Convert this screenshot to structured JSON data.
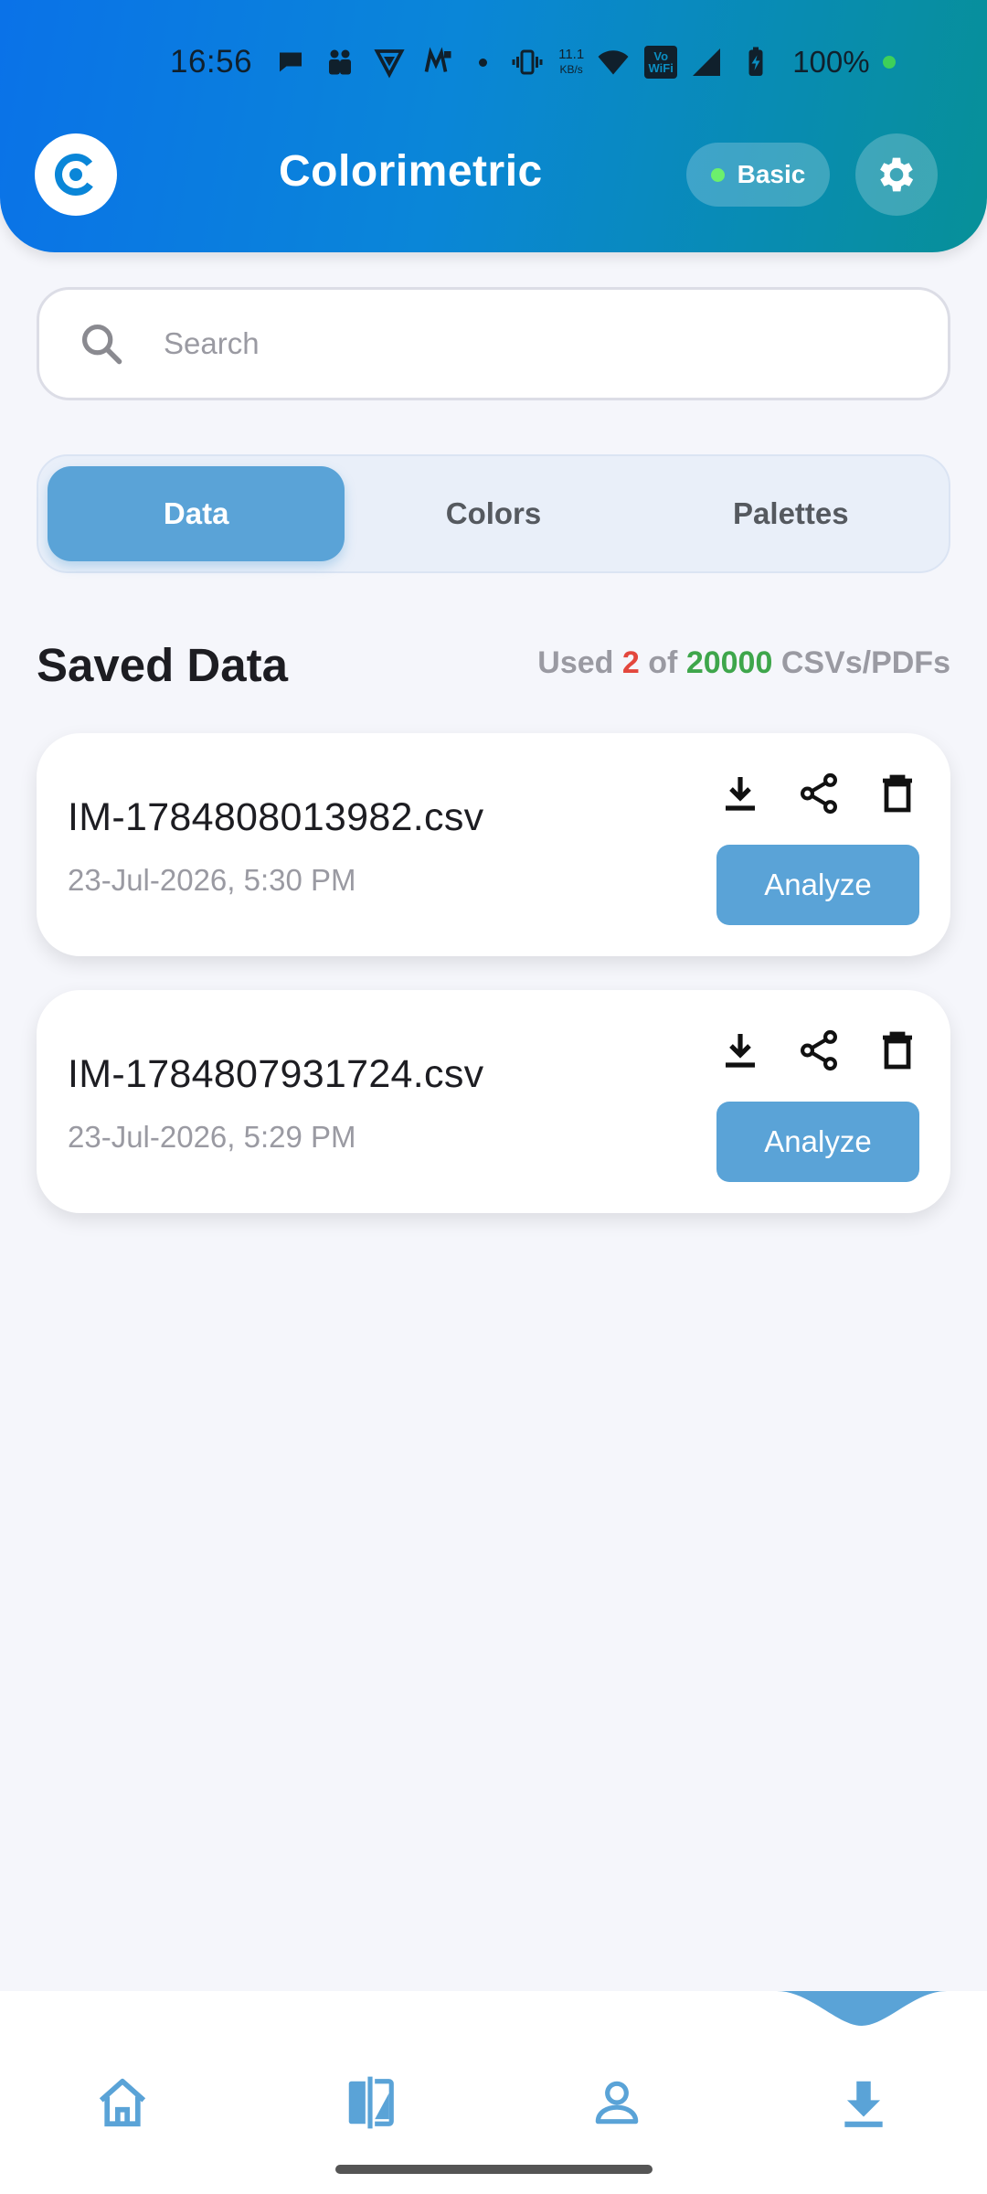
{
  "status_bar": {
    "time": "16:56",
    "net_speed_value": "11.1",
    "net_speed_unit": "KB/s",
    "wifi_badge": "Vo WiFi",
    "battery": "100%"
  },
  "header": {
    "title": "Colorimetric",
    "plan_label": "Basic",
    "icons": [
      "app-logo-icon",
      "gear-icon"
    ]
  },
  "search": {
    "placeholder": "Search",
    "value": ""
  },
  "tabs": [
    {
      "label": "Data",
      "active": true
    },
    {
      "label": "Colors",
      "active": false
    },
    {
      "label": "Palettes",
      "active": false
    }
  ],
  "section": {
    "title": "Saved Data",
    "usage_prefix": "Used",
    "usage_used": "2",
    "usage_of": "of",
    "usage_limit": "20000",
    "usage_suffix": "CSVs/PDFs"
  },
  "files": [
    {
      "name": "IM-1784808013982.csv",
      "date": "23-Jul-2026, 5:30 PM",
      "action_label": "Analyze"
    },
    {
      "name": "IM-1784807931724.csv",
      "date": "23-Jul-2026, 5:29 PM",
      "action_label": "Analyze"
    }
  ],
  "bottom_nav": {
    "items": [
      "home-icon",
      "compare-icon",
      "profile-icon",
      "download-icon"
    ],
    "active": "download-icon"
  },
  "colors": {
    "accent": "#5aa3d7",
    "header_gradient_start": "#0a72e8",
    "header_gradient_end": "#079098",
    "used_count": "#e3473d",
    "limit_count": "#3ea64b"
  }
}
